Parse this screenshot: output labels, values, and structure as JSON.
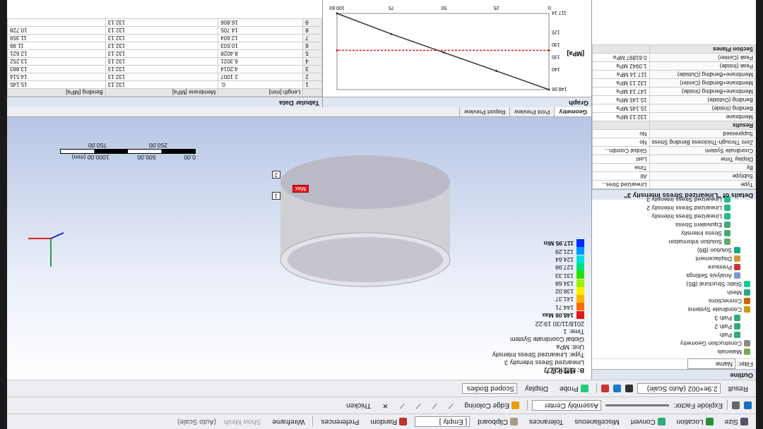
{
  "toolbar1": {
    "size": "Size",
    "location": "Location",
    "convert": "Convert",
    "miscellaneous": "Miscellaneous",
    "tolerances": "Tolerances",
    "clipboard": "Clipboard",
    "clipboard_value": "[ Empty ]",
    "random": "Random",
    "preferences": "Preferences",
    "wireframe": "Wireframe",
    "show_mesh": "Show Mesh",
    "auto_scale": "(Auto Scale)"
  },
  "toolbar2": {
    "explode_label": "Explode Factor:",
    "assembly_center": "Assembly Center",
    "edge_coloring": "Edge Coloring",
    "thicken": "Thicken"
  },
  "toolbar3": {
    "result_label": "Result",
    "result_value": "2.9e+002 (Auto Scale)",
    "probe": "Probe",
    "display": "Display",
    "scoped_bodies": "Scoped Bodies"
  },
  "outline": {
    "title": "Outline",
    "filter_label": "Filter:",
    "filter_value": "Name",
    "tree": [
      "Materials",
      "Construction Geometry",
      "Path",
      "Path 2",
      "Path 3",
      "Coordinate Systems",
      "Connections",
      "Mesh",
      "Static Structural (B5)",
      "Analysis Settings",
      "Pressure",
      "Displacement",
      "Solution (B6)",
      "Solution Information",
      "Stress Intensity",
      "Equivalent Stress",
      "Linearized Stress Intensity",
      "Linearized Stress Intensity 2",
      "Linearized Stress Intensity 3"
    ]
  },
  "details": {
    "title": "Details of \"Linearized Stress Intensity 3\"",
    "rows": [
      {
        "k": "Type",
        "v": "Linearized Stres...",
        "sec": false
      },
      {
        "k": "Subtype",
        "v": "All",
        "sec": false
      },
      {
        "k": "By",
        "v": "Time",
        "sec": false
      },
      {
        "k": "Display Time",
        "v": "Last",
        "sec": false
      },
      {
        "k": "Coordinate System",
        "v": "Global Coordin...",
        "sec": false
      },
      {
        "k": "Zero Through-Thickness Bending Stress",
        "v": "No",
        "sec": false
      },
      {
        "k": "Suppressed",
        "v": "No",
        "sec": false
      },
      {
        "k": "Results",
        "v": "",
        "sec": true
      },
      {
        "k": "Membrane",
        "v": "132.13 MPa",
        "sec": false
      },
      {
        "k": "Bending (Inside)",
        "v": "15.145 MPa",
        "sec": false
      },
      {
        "k": "Bending (Outside)",
        "v": "15.145 MPa",
        "sec": false
      },
      {
        "k": "Membrane+Bending (Inside)",
        "v": "147.14 MPa",
        "sec": false
      },
      {
        "k": "Membrane+Bending (Center)",
        "v": "132.13 MPa",
        "sec": false
      },
      {
        "k": "Membrane+Bending (Outside)",
        "v": "117.14 MPa",
        "sec": false
      },
      {
        "k": "Peak (Inside)",
        "v": "1.0942 MPa",
        "sec": false
      },
      {
        "k": "Peak (Center)",
        "v": "0.61897 MPa",
        "sec": false
      },
      {
        "k": "Section Planes",
        "v": "",
        "sec": true
      }
    ]
  },
  "viewport": {
    "title_cn": "B: 线性化应力",
    "lines": [
      "Linearized Stress Intensity 3",
      "Type: Linearized Stress Intensity",
      "Unit: MPa",
      "Global Coordinate System",
      "Time: 1",
      "2018/11/30 19:22"
    ],
    "legend_max": "148.06 Max",
    "legend_min": "117.95 Min",
    "legend_values": [
      "144.71",
      "141.37",
      "138.02",
      "134.68",
      "131.33",
      "127.98",
      "124.64",
      "121.29"
    ],
    "legend_colors": [
      "#e8141c",
      "#ff6a00",
      "#ffb400",
      "#f4f000",
      "#9ef000",
      "#28e000",
      "#00e07a",
      "#00e0e0",
      "#0096ff",
      "#0028ff"
    ],
    "max_tag": "Max",
    "probe1": "1",
    "probe2": "2",
    "scale_ticks": [
      "0.00",
      "500.00",
      "1000.00 (mm)"
    ],
    "scale_ticks2": [
      "250.00",
      "750.00"
    ],
    "tabs": [
      "Geometry",
      "Print Preview",
      "Report Preview"
    ]
  },
  "graph": {
    "title": "Graph",
    "ylabel": "[MPa]",
    "yticks": [
      "117.14",
      "125",
      "130",
      "135",
      "140",
      "148.06"
    ],
    "xticks": [
      "0.",
      "25",
      "50",
      "75",
      "100.83"
    ]
  },
  "tabular": {
    "title": "Tabular Data",
    "headers": [
      "",
      "Length [mm]",
      "Membrane [MPa]",
      "Bending [MPa]"
    ],
    "rows": [
      [
        "1",
        "0.",
        "132.13",
        "15.145"
      ],
      [
        "2",
        "2.1007",
        "132.13",
        "14.514"
      ],
      [
        "3",
        "4.2014",
        "132.13",
        "13.883"
      ],
      [
        "4",
        "6.3021",
        "132.13",
        "13.252"
      ],
      [
        "5",
        "8.4028",
        "132.13",
        "12.621"
      ],
      [
        "6",
        "10.503",
        "132.13",
        "11.99"
      ],
      [
        "7",
        "12.604",
        "132.13",
        "11.359"
      ],
      [
        "8",
        "14.705",
        "132.13",
        "10.728"
      ],
      [
        "9",
        "16.806",
        "132.13",
        ""
      ]
    ]
  },
  "chart_data": {
    "type": "line",
    "xlabel": "",
    "ylabel": "[MPa]",
    "xlim": [
      0,
      100.83
    ],
    "ylim": [
      117.14,
      148.06
    ],
    "series": [
      {
        "x": [
          0,
          25,
          50,
          75,
          100.83
        ],
        "values": [
          148.06,
          140.5,
          133.0,
          125.5,
          117.14
        ]
      },
      {
        "x": [
          0,
          100.83
        ],
        "values": [
          132.13,
          132.13
        ]
      }
    ]
  }
}
